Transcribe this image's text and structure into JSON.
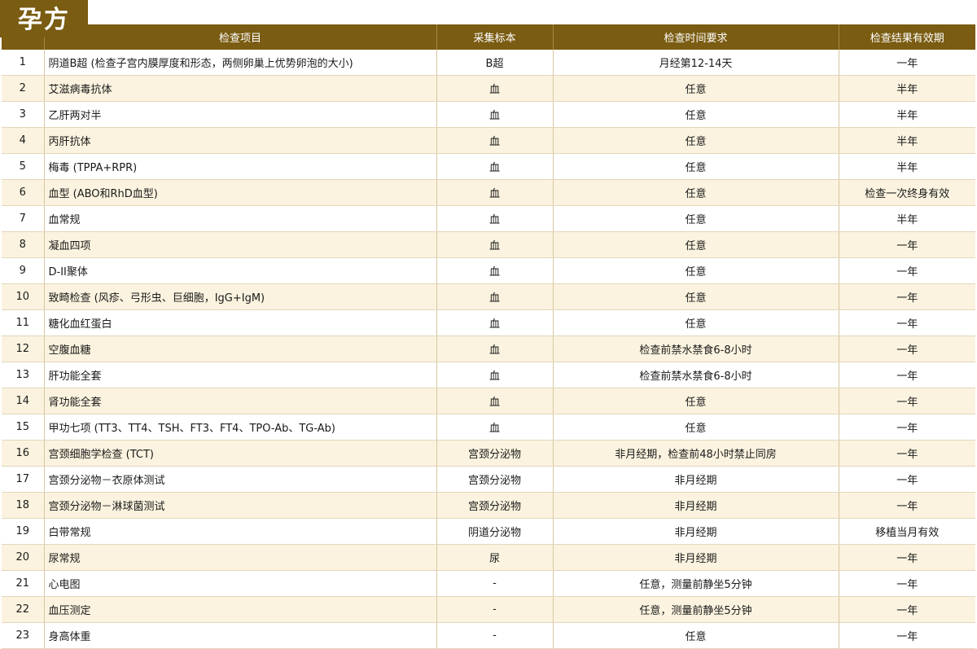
{
  "title": "孕方",
  "columns": [
    "",
    "检查项目",
    "采集标本",
    "检查时间要求",
    "检查结果有效期"
  ],
  "rows": [
    {
      "no": "1",
      "item": "阴道B超 (检查子宫内膜厚度和形态，两侧卵巢上优势卵泡的大小)",
      "sample": "B超",
      "time": "月经第12-14天",
      "valid": "一年"
    },
    {
      "no": "2",
      "item": "艾滋病毒抗体",
      "sample": "血",
      "time": "任意",
      "valid": "半年"
    },
    {
      "no": "3",
      "item": "乙肝两对半",
      "sample": "血",
      "time": "任意",
      "valid": "半年"
    },
    {
      "no": "4",
      "item": "丙肝抗体",
      "sample": "血",
      "time": "任意",
      "valid": "半年"
    },
    {
      "no": "5",
      "item": "梅毒 (TPPA+RPR)",
      "sample": "血",
      "time": "任意",
      "valid": "半年"
    },
    {
      "no": "6",
      "item": "血型 (ABO和RhD血型)",
      "sample": "血",
      "time": "任意",
      "valid": "检查一次终身有效"
    },
    {
      "no": "7",
      "item": "血常规",
      "sample": "血",
      "time": "任意",
      "valid": "半年"
    },
    {
      "no": "8",
      "item": "凝血四项",
      "sample": "血",
      "time": "任意",
      "valid": "一年"
    },
    {
      "no": "9",
      "item": "D-II聚体",
      "sample": "血",
      "time": "任意",
      "valid": "一年"
    },
    {
      "no": "10",
      "item": "致畸检查 (风疹、弓形虫、巨细胞，IgG+IgM)",
      "sample": "血",
      "time": "任意",
      "valid": "一年"
    },
    {
      "no": "11",
      "item": "糖化血红蛋白",
      "sample": "血",
      "time": "任意",
      "valid": "一年"
    },
    {
      "no": "12",
      "item": "空腹血糖",
      "sample": "血",
      "time": "检查前禁水禁食6-8小时",
      "valid": "一年"
    },
    {
      "no": "13",
      "item": "肝功能全套",
      "sample": "血",
      "time": "检查前禁水禁食6-8小时",
      "valid": "一年"
    },
    {
      "no": "14",
      "item": "肾功能全套",
      "sample": "血",
      "time": "任意",
      "valid": "一年"
    },
    {
      "no": "15",
      "item": "甲功七项 (TT3、TT4、TSH、FT3、FT4、TPO-Ab、TG-Ab)",
      "sample": "血",
      "time": "任意",
      "valid": "一年"
    },
    {
      "no": "16",
      "item": "宫颈细胞学检查 (TCT)",
      "sample": "宫颈分泌物",
      "time": "非月经期，检查前48小时禁止同房",
      "valid": "一年"
    },
    {
      "no": "17",
      "item": "宫颈分泌物－衣原体测试",
      "sample": "宫颈分泌物",
      "time": "非月经期",
      "valid": "一年"
    },
    {
      "no": "18",
      "item": "宫颈分泌物－淋球菌测试",
      "sample": "宫颈分泌物",
      "time": "非月经期",
      "valid": "一年"
    },
    {
      "no": "19",
      "item": "白带常规",
      "sample": "阴道分泌物",
      "time": "非月经期",
      "valid": "移植当月有效"
    },
    {
      "no": "20",
      "item": "尿常规",
      "sample": "尿",
      "time": "非月经期",
      "valid": "一年"
    },
    {
      "no": "21",
      "item": "心电图",
      "sample": "-",
      "time": "任意，测量前静坐5分钟",
      "valid": "一年"
    },
    {
      "no": "22",
      "item": "血压测定",
      "sample": "-",
      "time": "任意，测量前静坐5分钟",
      "valid": "一年"
    },
    {
      "no": "23",
      "item": "身高体重",
      "sample": "-",
      "time": "任意",
      "valid": "一年"
    }
  ],
  "colors": {
    "header_bg": "#7a5c12",
    "stripe_bg": "#fbf3df",
    "header_text": "#ffffff"
  }
}
